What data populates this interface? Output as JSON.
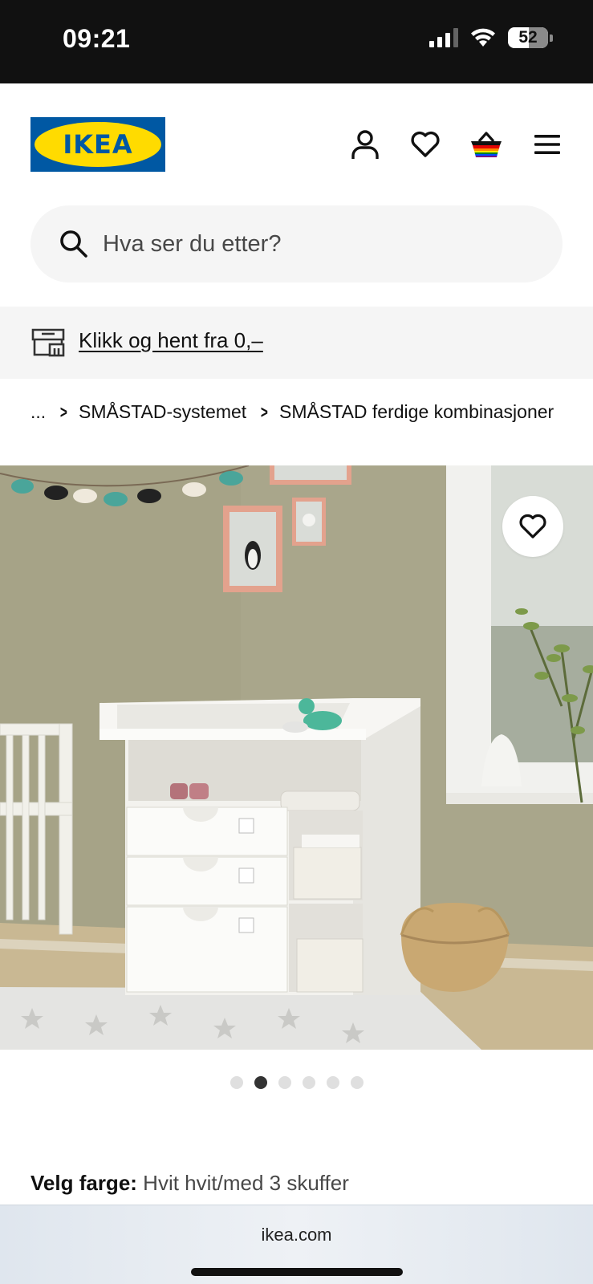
{
  "status_bar": {
    "time": "09:21",
    "battery": "52"
  },
  "header": {
    "logo_text": "IKEA",
    "icons": [
      "profile-icon",
      "heart-icon",
      "basket-icon",
      "menu-icon"
    ]
  },
  "search": {
    "placeholder": "Hva ser du etter?"
  },
  "banner": {
    "link_text": "Klikk og hent fra 0,–"
  },
  "breadcrumb": {
    "ellipsis": "...",
    "items": [
      "SMÅSTAD-systemet",
      "SMÅSTAD ferdige kombinasjoner"
    ]
  },
  "gallery": {
    "image_count": 6,
    "active_index": 1
  },
  "color_select": {
    "label": "Velg farge:",
    "value": "Hvit hvit/med 3 skuffer"
  },
  "browser": {
    "url": "ikea.com"
  },
  "colors": {
    "ikea_blue": "#0058a3",
    "ikea_yellow": "#ffdb00",
    "wall": "#a8a489"
  }
}
